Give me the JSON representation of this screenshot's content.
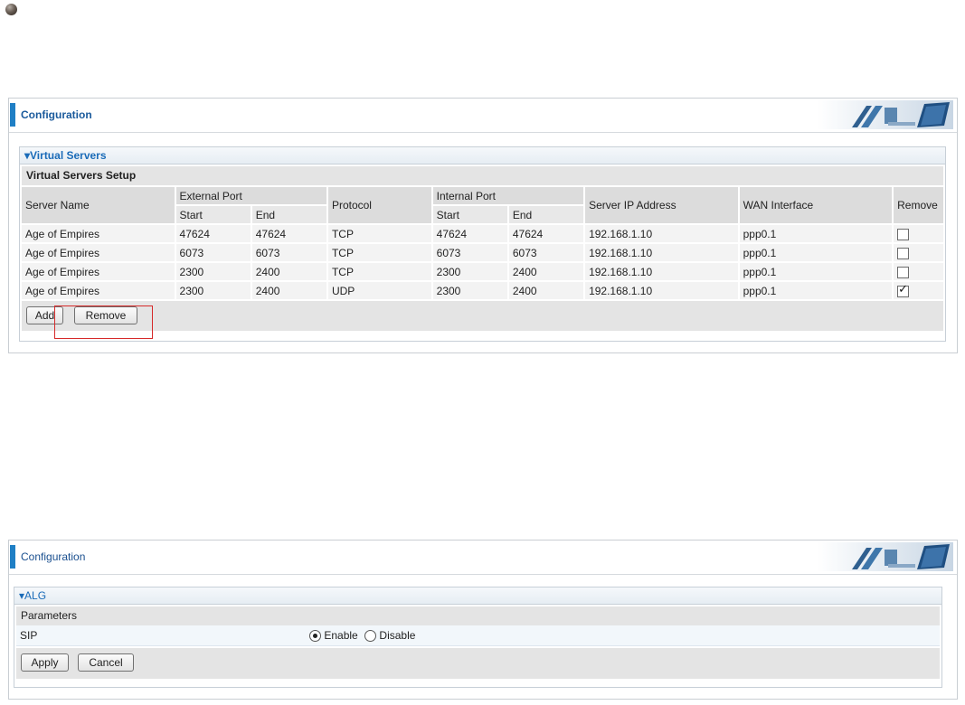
{
  "panel1": {
    "config_title": "Configuration",
    "section_title": "▾Virtual Servers",
    "setup_title": "Virtual Servers Setup",
    "columns": {
      "server_name": "Server Name",
      "external_port": "External Port",
      "protocol": "Protocol",
      "internal_port": "Internal Port",
      "server_ip": "Server IP Address",
      "wan_interface": "WAN Interface",
      "remove": "Remove",
      "start": "Start",
      "end": "End"
    },
    "rows": [
      {
        "name": "Age of Empires",
        "ext_start": "47624",
        "ext_end": "47624",
        "protocol": "TCP",
        "int_start": "47624",
        "int_end": "47624",
        "ip": "192.168.1.10",
        "wan": "ppp0.1",
        "remove": false
      },
      {
        "name": "Age of Empires",
        "ext_start": "6073",
        "ext_end": "6073",
        "protocol": "TCP",
        "int_start": "6073",
        "int_end": "6073",
        "ip": "192.168.1.10",
        "wan": "ppp0.1",
        "remove": false
      },
      {
        "name": "Age of Empires",
        "ext_start": "2300",
        "ext_end": "2400",
        "protocol": "TCP",
        "int_start": "2300",
        "int_end": "2400",
        "ip": "192.168.1.10",
        "wan": "ppp0.1",
        "remove": false
      },
      {
        "name": "Age of Empires",
        "ext_start": "2300",
        "ext_end": "2400",
        "protocol": "UDP",
        "int_start": "2300",
        "int_end": "2400",
        "ip": "192.168.1.10",
        "wan": "ppp0.1",
        "remove": true
      }
    ],
    "add_label": "Add",
    "remove_label": "Remove"
  },
  "panel2": {
    "config_title": "Configuration",
    "section_title": "▾ALG",
    "params_title": "Parameters",
    "sip_label": "SIP",
    "enable_label": "Enable",
    "disable_label": "Disable",
    "sip_enabled": true,
    "apply_label": "Apply",
    "cancel_label": "Cancel"
  },
  "colors": {
    "accent_bar": "#1f7fc5",
    "title_text": "#1a5a9c",
    "highlight": "#d62a2a"
  }
}
